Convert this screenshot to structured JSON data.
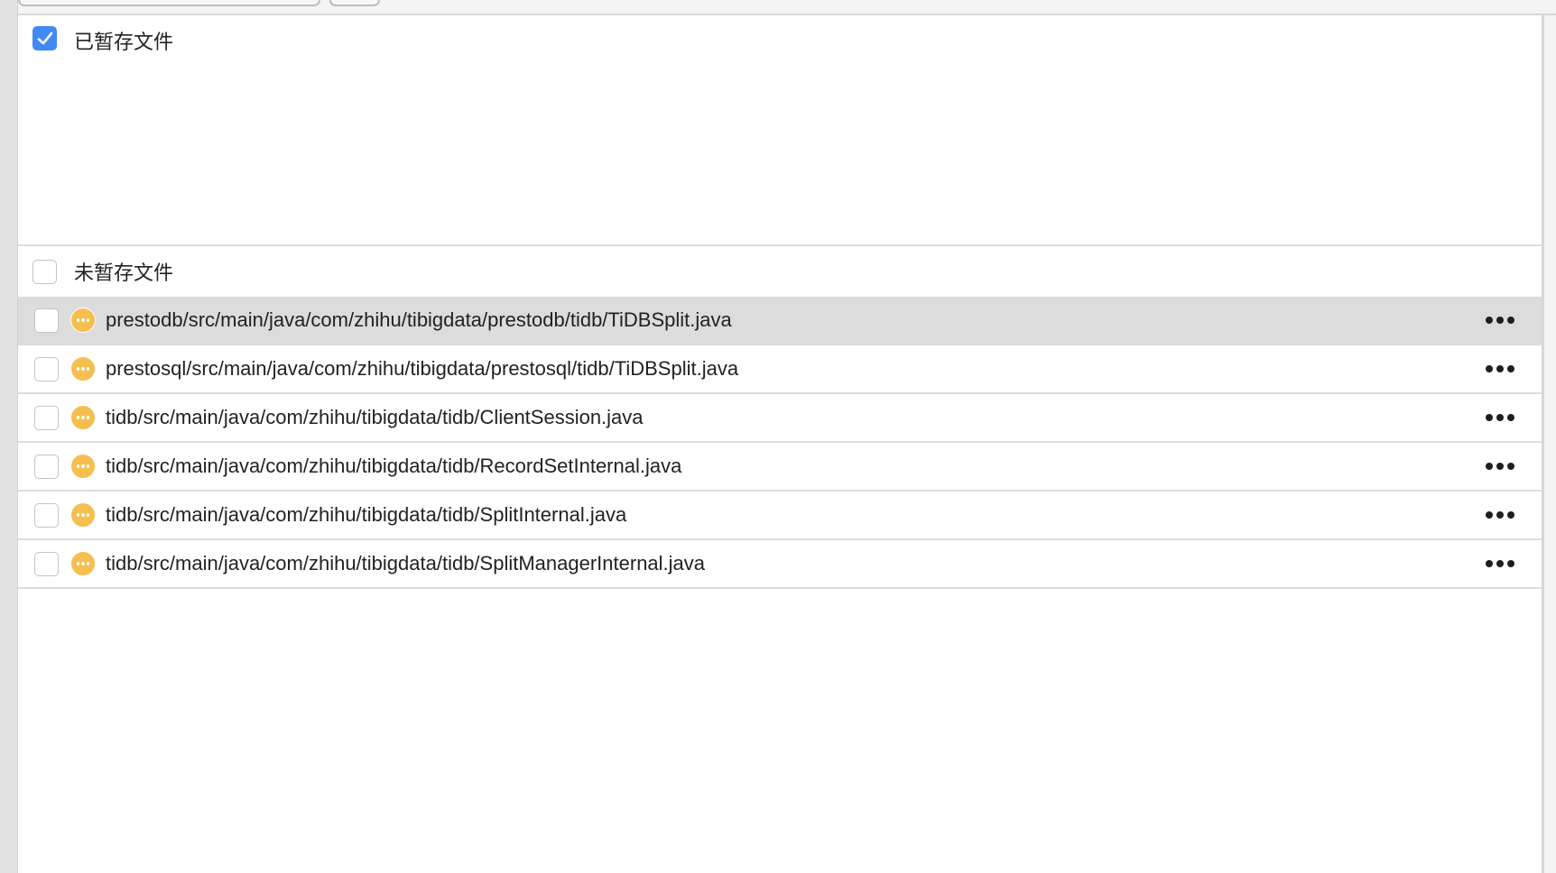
{
  "staged": {
    "label": "已暂存文件",
    "checked": true
  },
  "unstaged": {
    "label": "未暂存文件",
    "checked": false,
    "files": [
      {
        "path": "prestodb/src/main/java/com/zhihu/tibigdata/prestodb/tidb/TiDBSplit.java",
        "status": "modified",
        "selected": true
      },
      {
        "path": "prestosql/src/main/java/com/zhihu/tibigdata/prestosql/tidb/TiDBSplit.java",
        "status": "modified",
        "selected": false
      },
      {
        "path": "tidb/src/main/java/com/zhihu/tibigdata/tidb/ClientSession.java",
        "status": "modified",
        "selected": false
      },
      {
        "path": "tidb/src/main/java/com/zhihu/tibigdata/tidb/RecordSetInternal.java",
        "status": "modified",
        "selected": false
      },
      {
        "path": "tidb/src/main/java/com/zhihu/tibigdata/tidb/SplitInternal.java",
        "status": "modified",
        "selected": false
      },
      {
        "path": "tidb/src/main/java/com/zhihu/tibigdata/tidb/SplitManagerInternal.java",
        "status": "modified",
        "selected": false
      }
    ]
  },
  "colors": {
    "accent": "#3f8af5",
    "modified": "#f5bf4f",
    "selected_row": "#dcdcdc"
  }
}
